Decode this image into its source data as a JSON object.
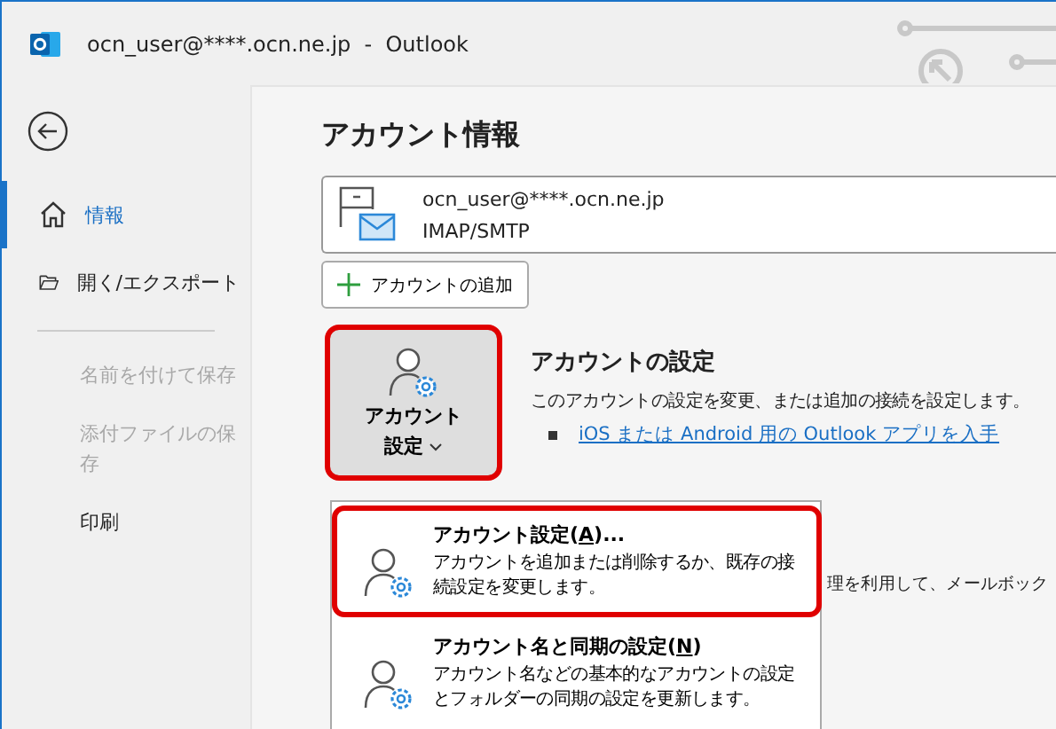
{
  "window": {
    "title": "ocn_user@****.ocn.ne.jp  -  Outlook"
  },
  "sidebar": {
    "items": [
      {
        "label": "情報",
        "kind": "home",
        "selected": true,
        "disabled": false
      },
      {
        "label": "開く/エクスポート",
        "kind": "folder",
        "selected": false,
        "disabled": false
      }
    ],
    "more_items": [
      {
        "label": "名前を付けて保存",
        "selected": false,
        "disabled": true
      },
      {
        "label": "添付ファイルの保存",
        "selected": false,
        "disabled": true
      },
      {
        "label": "印刷",
        "selected": false,
        "disabled": false
      }
    ]
  },
  "main": {
    "title": "アカウント情報",
    "account": {
      "email": "ocn_user@****.ocn.ne.jp",
      "type": "IMAP/SMTP"
    },
    "add_account_button": "アカウントの追加",
    "settings_button": {
      "label_lines": [
        "アカウント",
        "設定"
      ],
      "highlighted": true
    },
    "section": {
      "heading": "アカウントの設定",
      "description": "このアカウントの設定を変更、または追加の接続を設定します。",
      "link": "iOS または Android 用の Outlook アプリを入手"
    },
    "covered_text": "理を利用して、メールボック",
    "menu": [
      {
        "title_before": "アカウント設定(",
        "access_key": "A",
        "title_after": ")...",
        "description": "アカウントを追加または削除するか、既存の接続設定を変更します。",
        "highlighted": true
      },
      {
        "title_before": "アカウント名と同期の設定(",
        "access_key": "N",
        "title_after": ")",
        "description": "アカウント名などの基本的なアカウントの設定とフォルダーの同期の設定を更新します。",
        "highlighted": false
      }
    ]
  }
}
